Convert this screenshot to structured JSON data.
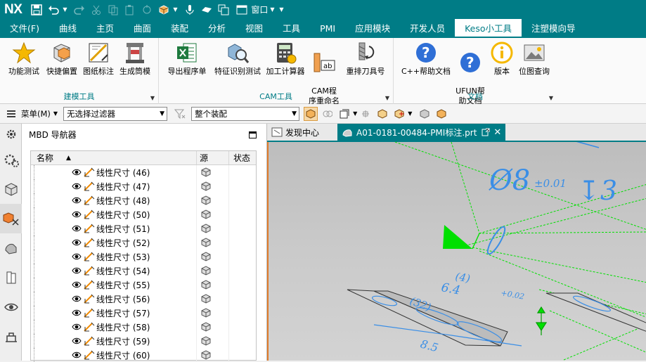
{
  "app": {
    "logo": "NX",
    "window_menu": "窗口"
  },
  "menubar": [
    "文件(F)",
    "曲线",
    "主页",
    "曲面",
    "装配",
    "分析",
    "视图",
    "工具",
    "PMI",
    "应用模块",
    "开发人员",
    "Keso小工具",
    "注塑模向导"
  ],
  "menubar_active": 11,
  "ribbon": {
    "groups": [
      {
        "label": "建模工具",
        "buttons": [
          "功能测试",
          "快捷偏置",
          "图纸标注",
          "生成筒模"
        ]
      },
      {
        "label": "CAM工具",
        "buttons": [
          "导出程序单",
          "特征识别测试",
          "加工计算器",
          "CAM程\n序重命名",
          "重排刀具号"
        ]
      },
      {
        "label": "文档",
        "buttons": [
          "C++帮助文档",
          "UFUN帮\n助文档",
          "版本",
          "位图查询"
        ]
      }
    ]
  },
  "selbar": {
    "menu_label": "菜单(M)",
    "filter": "无选择过滤器",
    "scope": "整个装配"
  },
  "navigator": {
    "title": "MBD 导航器",
    "columns": [
      "名称",
      "源",
      "状态"
    ],
    "rows": [
      "线性尺寸 (46)",
      "线性尺寸 (47)",
      "线性尺寸 (48)",
      "线性尺寸 (50)",
      "线性尺寸 (51)",
      "线性尺寸 (52)",
      "线性尺寸 (53)",
      "线性尺寸 (54)",
      "线性尺寸 (55)",
      "线性尺寸 (56)",
      "线性尺寸 (57)",
      "线性尺寸 (58)",
      "线性尺寸 (59)",
      "线性尺寸 (60)"
    ]
  },
  "doctabs": {
    "discover": "发现中心",
    "part": "A01-0181-00484-PMI标注.prt"
  },
  "graphics": {
    "dim_main": "Ø8",
    "dim_tol": "±0.01",
    "depth": "↧3",
    "ann1": "(4)",
    "ann2": "6.4",
    "ann3": "+0.02",
    "ann4": "(32)",
    "ann5": "8.5"
  },
  "colors": {
    "accent": "#007c86",
    "pmi_blue": "#3a8ee6",
    "green": "#00e000"
  }
}
